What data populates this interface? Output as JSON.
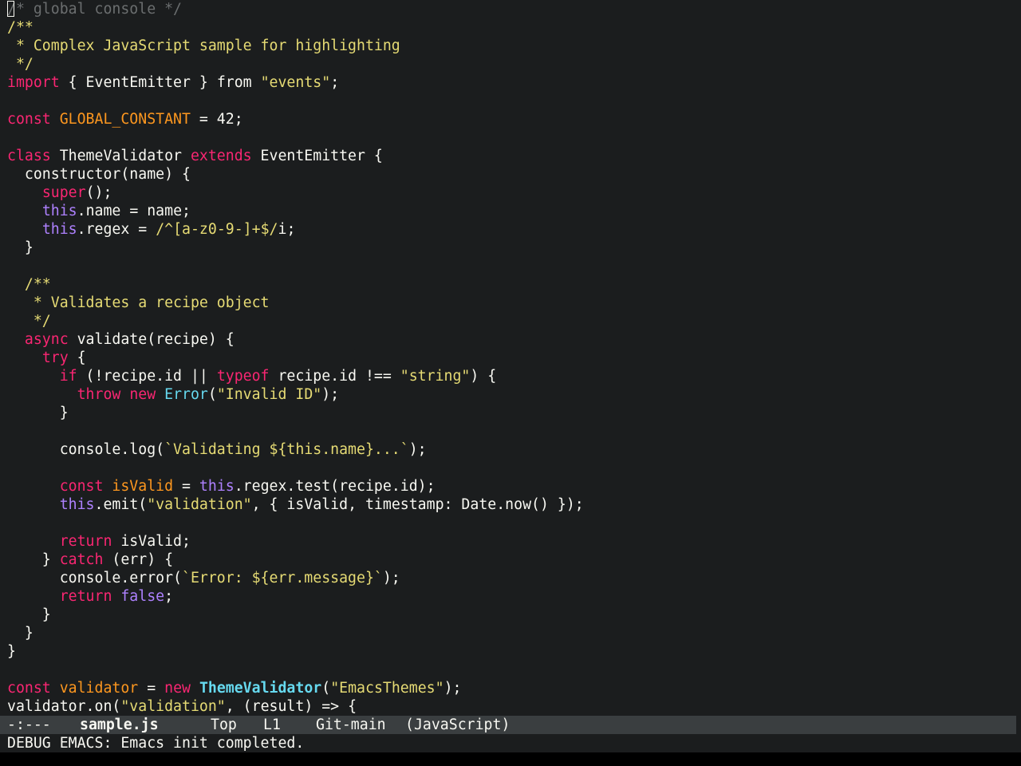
{
  "buffer": {
    "lines": [
      [
        [
          "/* global console */",
          "comment-dim"
        ]
      ],
      [
        [
          "/**",
          "comment"
        ]
      ],
      [
        [
          " * Complex JavaScript sample for highlighting",
          "comment"
        ]
      ],
      [
        [
          " */",
          "comment"
        ]
      ],
      [
        [
          "import",
          "keyword"
        ],
        [
          " { EventEmitter } ",
          "plain"
        ],
        [
          "from",
          "plain"
        ],
        [
          " ",
          "plain"
        ],
        [
          "\"events\"",
          "string"
        ],
        [
          ";",
          "plain"
        ]
      ],
      [],
      [
        [
          "const",
          "keyword"
        ],
        [
          " ",
          "plain"
        ],
        [
          "GLOBAL_CONSTANT",
          "var"
        ],
        [
          " = 42;",
          "plain"
        ]
      ],
      [],
      [
        [
          "class",
          "keyword"
        ],
        [
          " ThemeValidator ",
          "plain"
        ],
        [
          "extends",
          "keyword"
        ],
        [
          " EventEmitter {",
          "plain"
        ]
      ],
      [
        [
          "  constructor(name) {",
          "plain"
        ]
      ],
      [
        [
          "    ",
          "plain"
        ],
        [
          "super",
          "keyword"
        ],
        [
          "();",
          "plain"
        ]
      ],
      [
        [
          "    ",
          "plain"
        ],
        [
          "this",
          "builtin"
        ],
        [
          ".name = name;",
          "plain"
        ]
      ],
      [
        [
          "    ",
          "plain"
        ],
        [
          "this",
          "builtin"
        ],
        [
          ".regex = ",
          "plain"
        ],
        [
          "/^[a-z0-9-]+$/",
          "string"
        ],
        [
          "i;",
          "plain"
        ]
      ],
      [
        [
          "  }",
          "plain"
        ]
      ],
      [],
      [
        [
          "  /**",
          "comment"
        ]
      ],
      [
        [
          "   * Validates a recipe object",
          "comment"
        ]
      ],
      [
        [
          "   */",
          "comment"
        ]
      ],
      [
        [
          "  ",
          "plain"
        ],
        [
          "async",
          "keyword"
        ],
        [
          " validate(recipe) {",
          "plain"
        ]
      ],
      [
        [
          "    ",
          "plain"
        ],
        [
          "try",
          "keyword"
        ],
        [
          " {",
          "plain"
        ]
      ],
      [
        [
          "      ",
          "plain"
        ],
        [
          "if",
          "keyword"
        ],
        [
          " (!recipe.id || ",
          "plain"
        ],
        [
          "typeof",
          "keyword"
        ],
        [
          " recipe.id !== ",
          "plain"
        ],
        [
          "\"string\"",
          "string"
        ],
        [
          ") {",
          "plain"
        ]
      ],
      [
        [
          "        ",
          "plain"
        ],
        [
          "throw",
          "keyword"
        ],
        [
          " ",
          "plain"
        ],
        [
          "new",
          "keyword"
        ],
        [
          " ",
          "plain"
        ],
        [
          "Error",
          "type"
        ],
        [
          "(",
          "plain"
        ],
        [
          "\"Invalid ID\"",
          "string"
        ],
        [
          ");",
          "plain"
        ]
      ],
      [
        [
          "      }",
          "plain"
        ]
      ],
      [],
      [
        [
          "      console.log(",
          "plain"
        ],
        [
          "`Validating ${this.name}...`",
          "string"
        ],
        [
          ");",
          "plain"
        ]
      ],
      [],
      [
        [
          "      ",
          "plain"
        ],
        [
          "const",
          "keyword"
        ],
        [
          " ",
          "plain"
        ],
        [
          "isValid",
          "var"
        ],
        [
          " = ",
          "plain"
        ],
        [
          "this",
          "builtin"
        ],
        [
          ".regex.test(recipe.id);",
          "plain"
        ]
      ],
      [
        [
          "      ",
          "plain"
        ],
        [
          "this",
          "builtin"
        ],
        [
          ".emit(",
          "plain"
        ],
        [
          "\"validation\"",
          "string"
        ],
        [
          ", { isValid, timestamp: Date.now() });",
          "plain"
        ]
      ],
      [],
      [
        [
          "      ",
          "plain"
        ],
        [
          "return",
          "keyword"
        ],
        [
          " isValid;",
          "plain"
        ]
      ],
      [
        [
          "    } ",
          "plain"
        ],
        [
          "catch",
          "keyword"
        ],
        [
          " (err) {",
          "plain"
        ]
      ],
      [
        [
          "      console.error(",
          "plain"
        ],
        [
          "`Error: ${err.message}`",
          "string"
        ],
        [
          ");",
          "plain"
        ]
      ],
      [
        [
          "      ",
          "plain"
        ],
        [
          "return",
          "keyword"
        ],
        [
          " ",
          "plain"
        ],
        [
          "false",
          "builtin"
        ],
        [
          ";",
          "plain"
        ]
      ],
      [
        [
          "    }",
          "plain"
        ]
      ],
      [
        [
          "  }",
          "plain"
        ]
      ],
      [
        [
          "}",
          "plain"
        ]
      ],
      [],
      [
        [
          "const",
          "keyword"
        ],
        [
          " ",
          "plain"
        ],
        [
          "validator",
          "var"
        ],
        [
          " = ",
          "plain"
        ],
        [
          "new",
          "keyword"
        ],
        [
          " ",
          "plain"
        ],
        [
          "ThemeValidator",
          "type-bold"
        ],
        [
          "(",
          "plain"
        ],
        [
          "\"EmacsThemes\"",
          "string"
        ],
        [
          ");",
          "plain"
        ]
      ],
      [
        [
          "validator.on(",
          "plain"
        ],
        [
          "\"validation\"",
          "string"
        ],
        [
          ", (result) => {",
          "plain"
        ]
      ]
    ]
  },
  "modeline": {
    "status": "-:---",
    "buffer_name": "sample.js",
    "position": "Top",
    "line": "L1",
    "vc": "Git-main",
    "mode": "(JavaScript)"
  },
  "minibuffer": {
    "message": "DEBUG EMACS: Emacs init completed."
  },
  "colors": {
    "background": "#1b1d1e",
    "foreground": "#f8f8f2",
    "keyword": "#f92672",
    "string": "#e6db74",
    "variable": "#fd971f",
    "builtin": "#ae81ff",
    "type": "#66d9ef",
    "modeline_bg": "#3a3e40"
  }
}
